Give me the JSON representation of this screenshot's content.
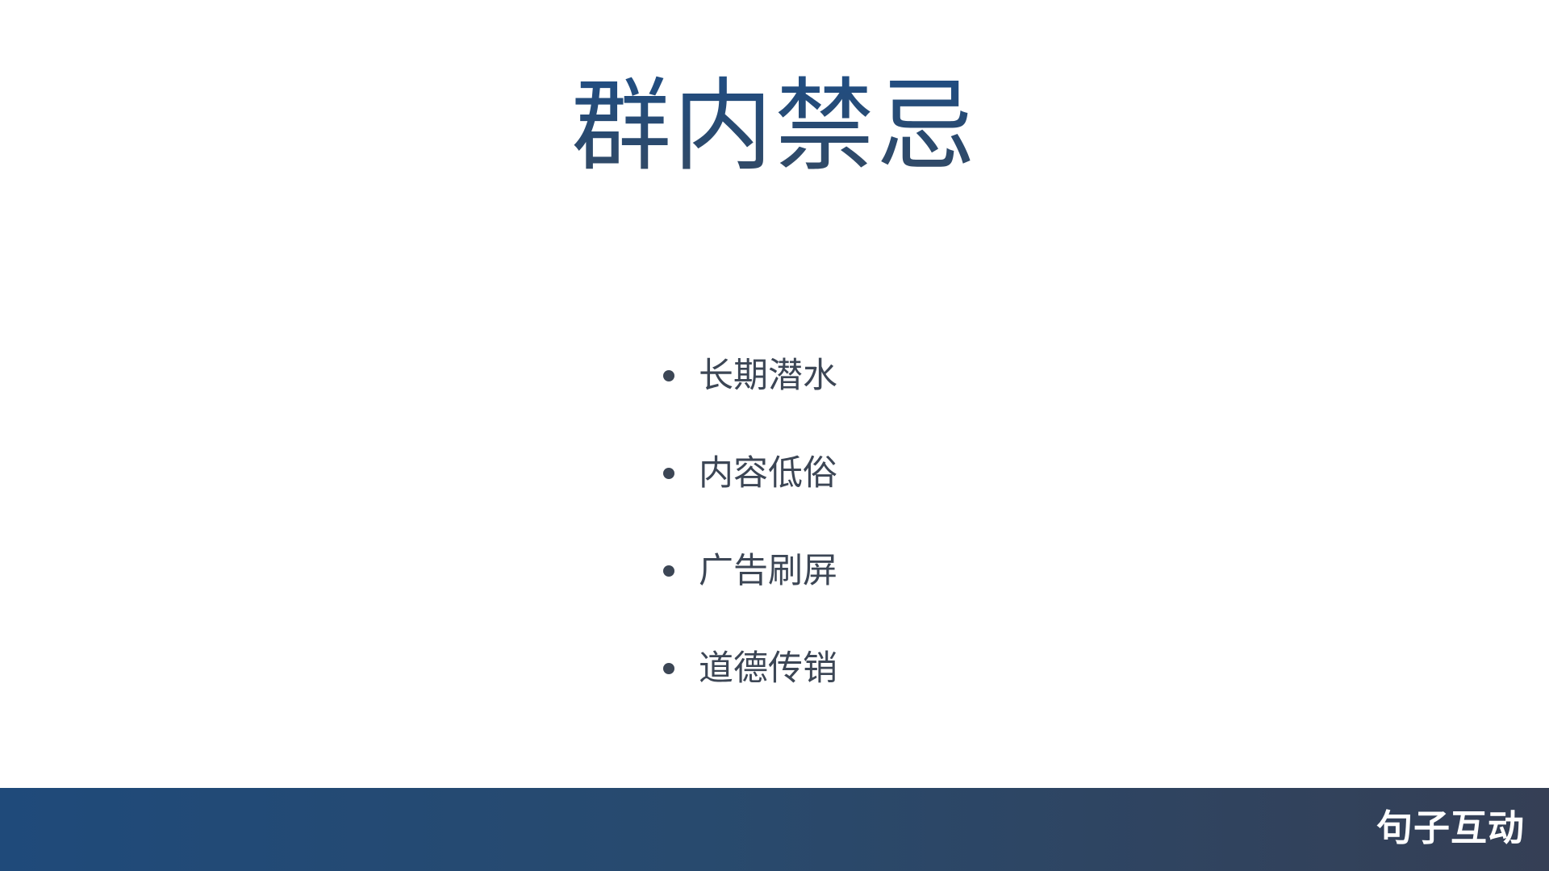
{
  "slide": {
    "title": "群内禁忌",
    "bullets": [
      "长期潜水",
      "内容低俗",
      "广告刷屏",
      "道德传销"
    ]
  },
  "footer": {
    "brand": "句子互动"
  },
  "colors": {
    "title": "#244d7c",
    "bullet_text": "#3c4655",
    "footer_start": "#1f4a7a",
    "footer_end": "#353f55",
    "footer_text": "#ffffff",
    "background": "#ffffff"
  }
}
